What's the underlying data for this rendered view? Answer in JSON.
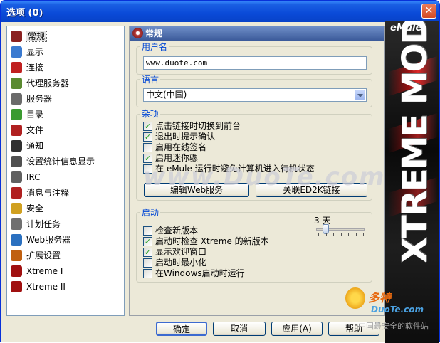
{
  "window": {
    "title": "选项 (0)",
    "close_label": "✕"
  },
  "nav": {
    "items": [
      {
        "label": "常规",
        "icon": "gear-icon",
        "color": "#8a2020",
        "selected": true
      },
      {
        "label": "显示",
        "icon": "monitor-icon",
        "color": "#3a7ad0"
      },
      {
        "label": "连接",
        "icon": "plug-icon",
        "color": "#c02020"
      },
      {
        "label": "代理服务器",
        "icon": "proxy-icon",
        "color": "#5a8a30"
      },
      {
        "label": "服务器",
        "icon": "server-icon",
        "color": "#6a6a6a"
      },
      {
        "label": "目录",
        "icon": "folder-icon",
        "color": "#3a9a30"
      },
      {
        "label": "文件",
        "icon": "file-icon",
        "color": "#b02020"
      },
      {
        "label": "通知",
        "icon": "notify-icon",
        "color": "#303030"
      },
      {
        "label": "设置统计信息显示",
        "icon": "stats-icon",
        "color": "#505050"
      },
      {
        "label": "IRC",
        "icon": "irc-icon",
        "color": "#606060"
      },
      {
        "label": "消息与注释",
        "icon": "message-icon",
        "color": "#b02020"
      },
      {
        "label": "安全",
        "icon": "lock-icon",
        "color": "#d0a020"
      },
      {
        "label": "计划任务",
        "icon": "calendar-icon",
        "color": "#707070"
      },
      {
        "label": "Web服务器",
        "icon": "globe-icon",
        "color": "#2a70c0"
      },
      {
        "label": "扩展设置",
        "icon": "puzzle-icon",
        "color": "#c06010"
      },
      {
        "label": "Xtreme I",
        "icon": "xtreme-icon",
        "color": "#a01010"
      },
      {
        "label": "Xtreme II",
        "icon": "xtreme-icon",
        "color": "#a01010"
      }
    ]
  },
  "panel": {
    "header": "常规",
    "username": {
      "title": "用户名",
      "value": "www.duote.com"
    },
    "language": {
      "title": "语言",
      "selected": "中文(中国)"
    },
    "misc": {
      "title": "杂项",
      "options": [
        {
          "label": "点击链接时切换到前台",
          "checked": true
        },
        {
          "label": "退出时提示确认",
          "checked": true
        },
        {
          "label": "启用在线签名",
          "checked": false
        },
        {
          "label": "启用迷你骡",
          "checked": true
        },
        {
          "label": "在 eMule 运行时避免计算机进入待机状态",
          "checked": false
        }
      ],
      "edit_web_button": "编辑Web服务",
      "assoc_ed2k_button": "关联ED2K链接"
    },
    "startup": {
      "title": "启动",
      "interval_label": "3 天",
      "interval_days": 3,
      "options": [
        {
          "label": "检查新版本",
          "checked": false
        },
        {
          "label": "启动时检查 Xtreme 的新版本",
          "checked": true
        },
        {
          "label": "显示欢迎窗口",
          "checked": true
        },
        {
          "label": "启动时最小化",
          "checked": false
        },
        {
          "label": "在Windows启动时运行",
          "checked": false
        }
      ]
    }
  },
  "buttons": {
    "ok": "确定",
    "cancel": "取消",
    "apply": "应用(A)",
    "help": "帮助"
  },
  "banner": {
    "logo": "eMule",
    "mod": "XTREME MOD"
  },
  "watermark": {
    "url": "www.DuoTe.com",
    "site_name": "多特",
    "site_url": "DuoTe.com",
    "slogan": "中国最安全的软件站"
  }
}
